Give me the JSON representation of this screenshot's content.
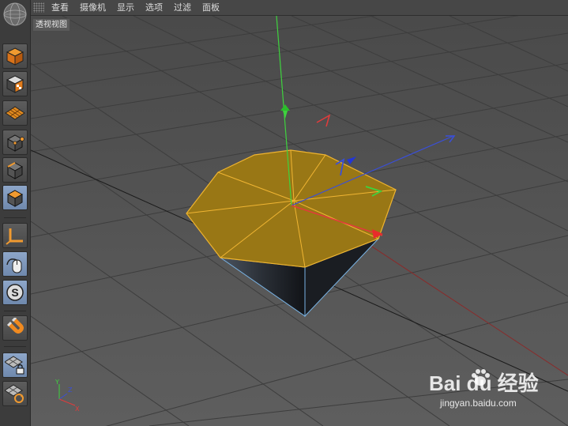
{
  "menubar": {
    "items": [
      "查看",
      "摄像机",
      "显示",
      "选项",
      "过滤",
      "面板"
    ]
  },
  "viewport": {
    "label": "透视视图"
  },
  "axis_gizmo": {
    "y": "Y",
    "z": "Z",
    "x": "X"
  },
  "toolbar": {
    "tools": [
      "model-mode",
      "texture-mode",
      "workplane-mode",
      "point-mode",
      "edge-mode",
      "polygon-mode",
      "axis-mode",
      "tweak-mode",
      "solo-mode",
      "snap-magnet",
      "workplane-lock",
      "workplane-cycle"
    ]
  },
  "watermark": {
    "brand": "Bai du 经验",
    "url": "jingyan.baidu.com"
  },
  "colors": {
    "selection": "#ebb019",
    "axis_x": "#e23b3b",
    "axis_y": "#3ed23e",
    "axis_z": "#3a4fd8",
    "active_tool": "#7b95b9"
  }
}
